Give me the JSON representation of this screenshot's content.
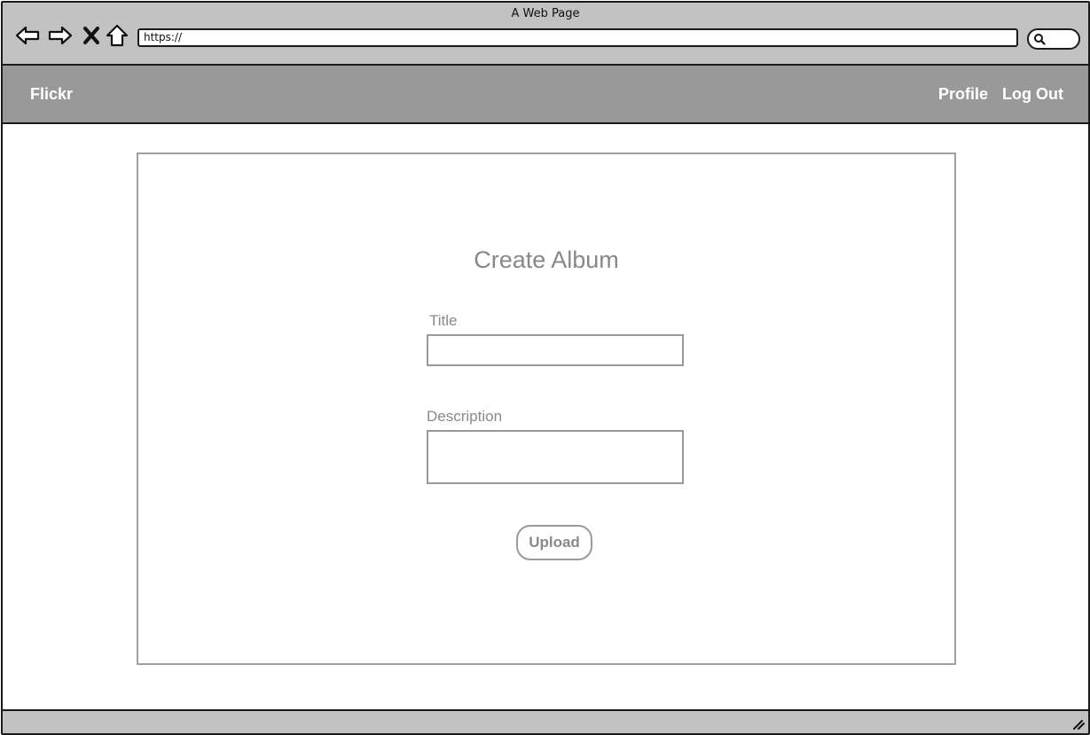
{
  "browser": {
    "window_title": "A Web Page",
    "url": "https://",
    "icons": {
      "back": "back-arrow-icon",
      "forward": "forward-arrow-icon",
      "stop": "close-icon",
      "home": "home-icon",
      "search": "search-icon",
      "resize": "resize-grip-icon"
    }
  },
  "navbar": {
    "brand": "Flickr",
    "links": [
      "Profile",
      "Log Out"
    ]
  },
  "form": {
    "heading": "Create Album",
    "title_label": "Title",
    "title_value": "",
    "description_label": "Description",
    "description_value": "",
    "submit_label": "Upload"
  },
  "colors": {
    "chrome_bg": "#c2c2c2",
    "navbar_bg": "#999999",
    "navbar_text": "#ffffff",
    "muted_text": "#888888",
    "border": "#1a1a1a"
  }
}
